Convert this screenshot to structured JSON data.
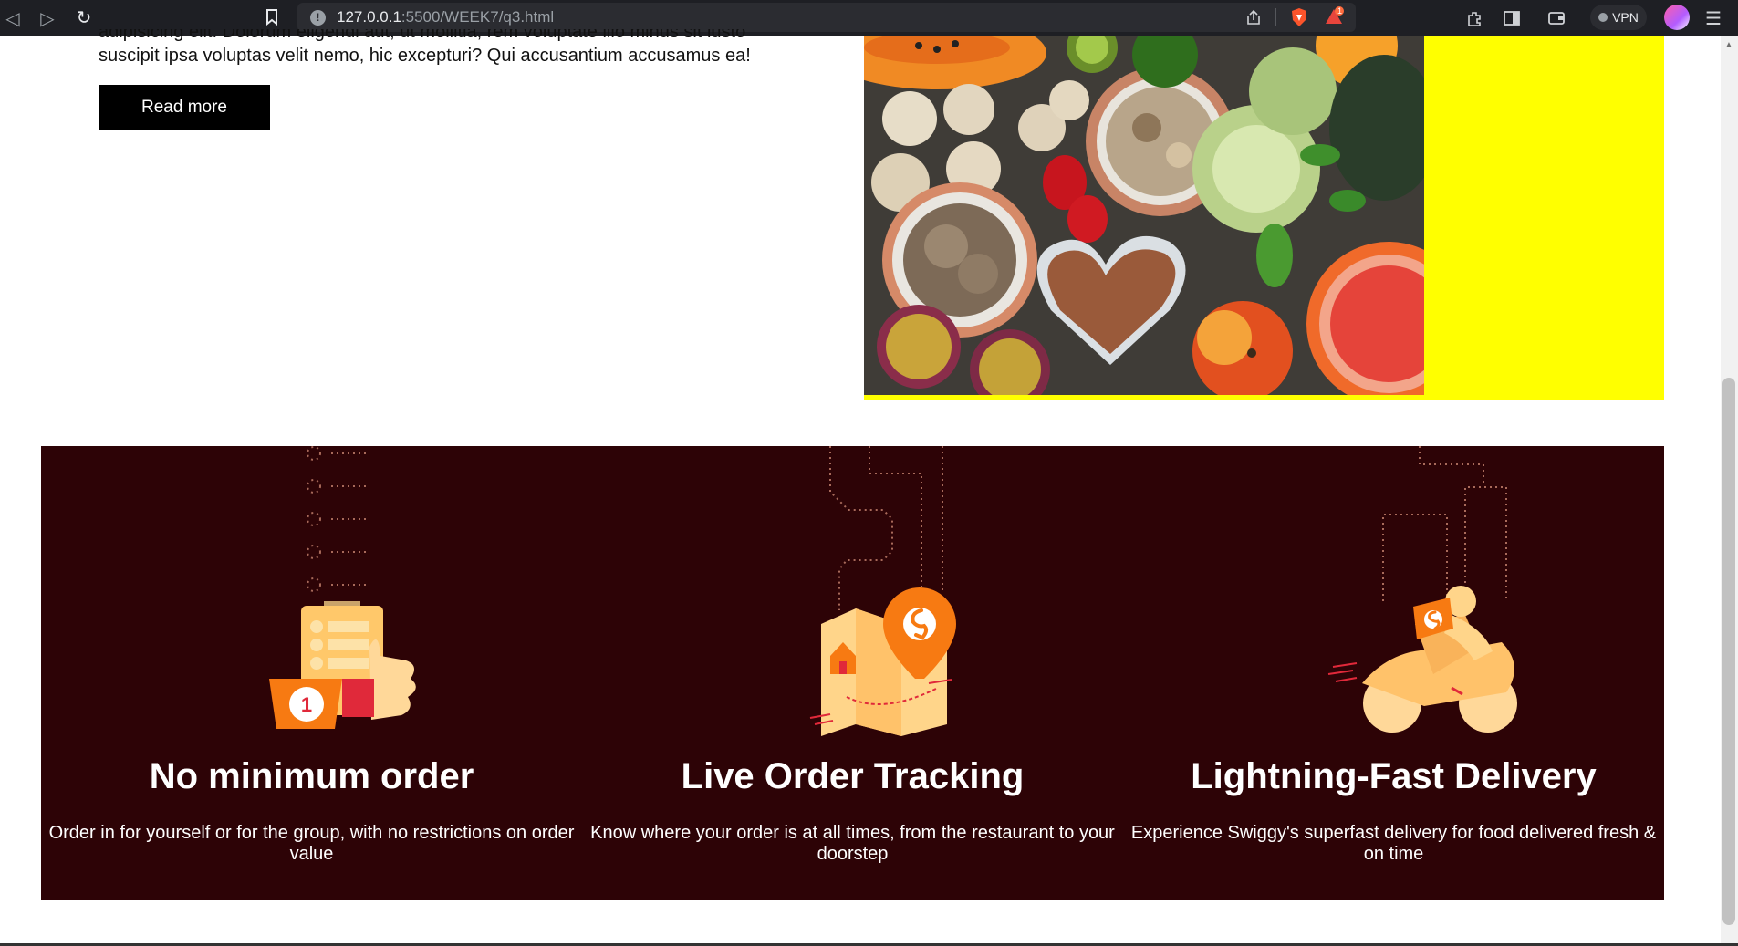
{
  "browser": {
    "url_host": "127.0.0.1",
    "url_path": ":5500/WEEK7/q3.html",
    "vpn_label": "VPN",
    "brave_badge": "1",
    "back_icon": "back-arrow-icon",
    "forward_icon": "forward-arrow-icon",
    "reload_icon": "reload-icon"
  },
  "article": {
    "cut_line": "adipisicing elit. Dolorum eligendi aut, ut mollitia, rem voluptate illo minus sit iusto",
    "text_line": "suscipit ipsa voluptas velit nemo, hic excepturi? Qui accusantium accusamus ea!",
    "read_more": "Read more"
  },
  "features": [
    {
      "title": "No minimum order",
      "description": "Order in for yourself or for the group, with no restrictions on order value",
      "badge": "1",
      "icon": "order-thumbs-up-icon"
    },
    {
      "title": "Live Order Tracking",
      "description": "Know where your order is at all times, from the restaurant to your doorstep",
      "icon": "map-pin-tracking-icon"
    },
    {
      "title": "Lightning-Fast Delivery",
      "description": "Experience Swiggy's superfast delivery for food delivered fresh & on time",
      "icon": "delivery-scooter-icon"
    }
  ],
  "colors": {
    "features_bg": "#2d0306",
    "accent_orange": "#fc8019",
    "highlight_yellow": "#ffff00"
  }
}
